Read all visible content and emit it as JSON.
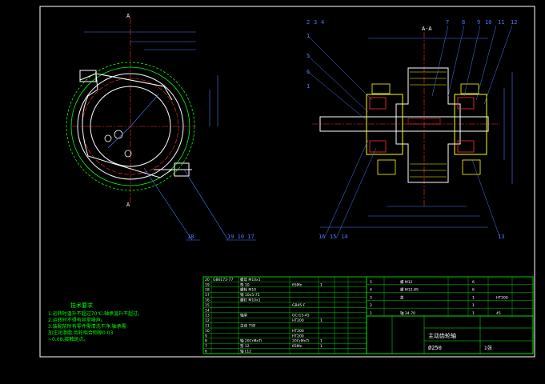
{
  "drawing": {
    "section_label": "A-A",
    "cut_marks": [
      "A",
      "A"
    ],
    "title_block": {
      "name": "主动齿轮轴",
      "spec": "Ø250",
      "sheet": "1张"
    },
    "balloons_top": [
      "2",
      "3",
      "4",
      "7",
      "8",
      "9",
      "10",
      "11",
      "12"
    ],
    "balloons_left": [
      "1",
      "5",
      "6",
      "1"
    ],
    "balloons_bottom": [
      "16",
      "15",
      "14",
      "13"
    ],
    "balloons_front": [
      "18",
      "19 10 17"
    ],
    "notes_title": "技术要求",
    "notes": [
      "1.运转时温升不超过70℃,轴承温升不超过。",
      "2.运转时不得有异常噪声。",
      "3.装配前所有零件需清洗干净,轴承需",
      "  加注润滑脂,齿轮啮合侧隙0.03",
      "  ~0.08,接触斑点。"
    ],
    "bom_left": [
      {
        "no": "20",
        "code": "GB6172-77",
        "name": "螺母 M10x1",
        "qty": "",
        "mat": "",
        "wt": ""
      },
      {
        "no": "19",
        "code": "",
        "name": "垫 10",
        "qty": "65Mn",
        "mat": "1",
        "wt": ""
      },
      {
        "no": "18",
        "code": "",
        "name": "螺栓 M10",
        "qty": "",
        "mat": "",
        "wt": ""
      },
      {
        "no": "17",
        "code": "",
        "name": "销 10x5-75",
        "qty": "",
        "mat": "",
        "wt": ""
      },
      {
        "no": "16",
        "code": "",
        "name": "螺钉 M10x1",
        "qty": "",
        "mat": "",
        "wt": ""
      },
      {
        "no": "15",
        "code": "",
        "name": "",
        "qty": "GB45-F",
        "mat": "",
        "wt": ""
      },
      {
        "no": "14",
        "code": "",
        "name": "",
        "qty": "",
        "mat": "",
        "wt": ""
      },
      {
        "no": "13",
        "code": "",
        "name": "轴承",
        "qty": "GCr15-45",
        "mat": "",
        "wt": ""
      },
      {
        "no": "12",
        "code": "",
        "name": "",
        "qty": "HT200",
        "mat": "1",
        "wt": ""
      },
      {
        "no": "11",
        "code": "",
        "name": "主动 75B",
        "qty": "",
        "mat": "",
        "wt": ""
      },
      {
        "no": "10",
        "code": "",
        "name": "",
        "qty": "HT200",
        "mat": "",
        "wt": ""
      },
      {
        "no": "9",
        "code": "",
        "name": "",
        "qty": "HT200",
        "mat": "",
        "wt": ""
      },
      {
        "no": "8",
        "code": "",
        "name": "轴 20CrMnTi",
        "qty": "20CrMnTi",
        "mat": "1",
        "wt": ""
      },
      {
        "no": "7",
        "code": "",
        "name": "垫 12",
        "qty": "65Mn",
        "mat": "1",
        "wt": ""
      },
      {
        "no": "6",
        "code": "",
        "name": "轴 L12",
        "qty": "",
        "mat": "",
        "wt": ""
      }
    ],
    "bom_right": [
      {
        "no": "5",
        "name": "螺 M12",
        "qty": "6",
        "mat": ""
      },
      {
        "no": "4",
        "name": "螺 M12-8S",
        "qty": "6",
        "mat": ""
      },
      {
        "no": "3",
        "name": "盖",
        "qty": "1",
        "mat": "HT200"
      },
      {
        "no": "2",
        "name": "",
        "qty": "1",
        "mat": ""
      },
      {
        "no": "1",
        "name": "轴 34-70",
        "qty": "1",
        "mat": "45"
      }
    ]
  }
}
